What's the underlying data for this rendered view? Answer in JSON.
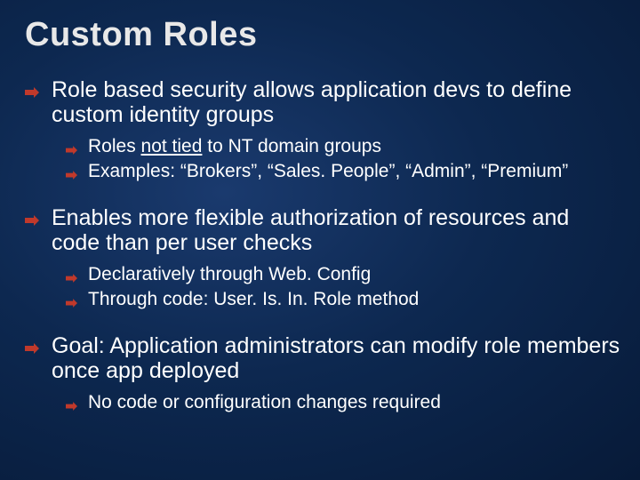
{
  "title": "Custom Roles",
  "bullets": [
    {
      "text": "Role based security allows application devs to define custom identity groups",
      "sub": [
        {
          "pre": "Roles ",
          "u": "not tied",
          "post": " to NT domain groups"
        },
        {
          "text": "Examples: “Brokers”, “Sales. People”, “Admin”, “Premium”"
        }
      ]
    },
    {
      "text": "Enables more flexible authorization of resources and code than per user checks",
      "sub": [
        {
          "text": "Declaratively through Web. Config"
        },
        {
          "text": "Through code: User. Is. In. Role method"
        }
      ]
    },
    {
      "text": "Goal: Application administrators can modify role members once app deployed",
      "sub": [
        {
          "text": "No code or configuration changes required"
        }
      ]
    }
  ]
}
